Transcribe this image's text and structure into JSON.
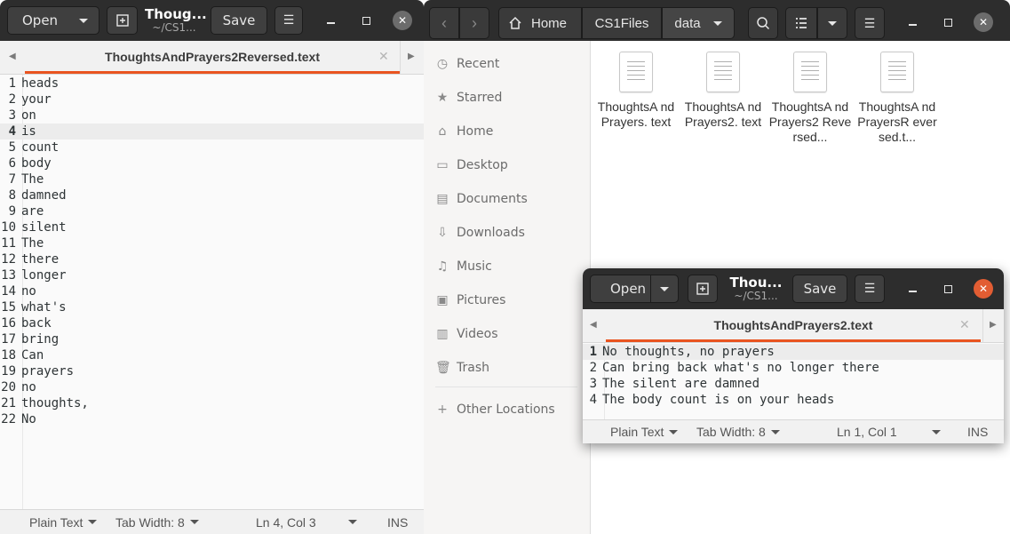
{
  "editor_window": {
    "open_label": "Open",
    "title": "Thoug...",
    "subtitle": "~/CS1...",
    "save_label": "Save",
    "tab_name": "ThoughtsAndPrayers2Reversed.text",
    "lines": [
      "heads",
      "your",
      "on",
      "is",
      "count",
      "body",
      "The",
      "damned",
      "are",
      "silent",
      "The",
      "there",
      "longer",
      "no",
      "what's",
      "back",
      "bring",
      "Can",
      "prayers",
      "no",
      "thoughts,",
      "No"
    ],
    "current_line": 4,
    "status": {
      "lang": "Plain Text",
      "tab_width": "Tab Width: 8",
      "position": "Ln 4, Col 3",
      "mode": "INS"
    }
  },
  "files_window": {
    "path": [
      "Home",
      "CS1Files",
      "data"
    ],
    "sidebar": [
      {
        "label": "Recent",
        "icon": "clock-icon"
      },
      {
        "label": "Starred",
        "icon": "star-icon"
      },
      {
        "label": "Home",
        "icon": "home-icon"
      },
      {
        "label": "Desktop",
        "icon": "desktop-icon"
      },
      {
        "label": "Documents",
        "icon": "documents-icon"
      },
      {
        "label": "Downloads",
        "icon": "download-icon"
      },
      {
        "label": "Music",
        "icon": "music-icon"
      },
      {
        "label": "Pictures",
        "icon": "pictures-icon"
      },
      {
        "label": "Videos",
        "icon": "videos-icon"
      },
      {
        "label": "Trash",
        "icon": "trash-icon"
      },
      {
        "label": "Other Locations",
        "icon": "plus-icon"
      }
    ],
    "files": [
      "ThoughtsA ndPrayers. text",
      "ThoughtsA ndPrayers2. text",
      "ThoughtsA ndPrayers2 Reversed...",
      "ThoughtsA ndPrayersR eversed.t..."
    ]
  },
  "small_editor": {
    "open_label": "Open",
    "title": "Thou...",
    "subtitle": "~/CS1...",
    "save_label": "Save",
    "tab_name": "ThoughtsAndPrayers2.text",
    "lines": [
      "No thoughts, no prayers",
      "Can bring back what's no longer there",
      "The silent are damned",
      "The body count is on your heads"
    ],
    "current_line": 1,
    "status": {
      "lang": "Plain Text",
      "tab_width": "Tab Width: 8",
      "position": "Ln 1, Col 1",
      "mode": "INS"
    }
  },
  "colors": {
    "accent": "#e95420",
    "header": "#2d2d2d",
    "close": "#e25d33"
  }
}
